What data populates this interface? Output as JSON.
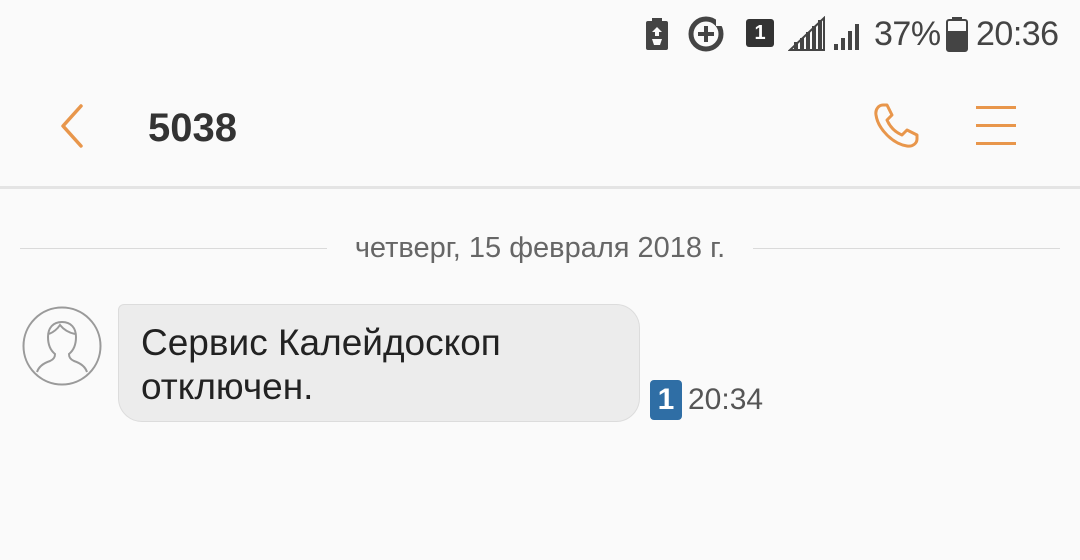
{
  "status_bar": {
    "sim_badge": "1",
    "battery_percent": "37%",
    "time": "20:36",
    "icons": [
      "battery-saver-icon",
      "data-saver-icon",
      "sim-1-icon",
      "signal-strength-icon",
      "signal-strength-icon",
      "battery-icon"
    ]
  },
  "header": {
    "title": "5038",
    "back_icon": "chevron-left-icon",
    "call_icon": "phone-icon",
    "menu_icon": "menu-icon",
    "accent_color": "#e8964b"
  },
  "conversation": {
    "date_divider": "четверг, 15 февраля 2018 г.",
    "messages": [
      {
        "direction": "incoming",
        "text": "Сервис Калейдоскоп отключен.",
        "sim": "1",
        "time": "20:34",
        "avatar_icon": "person-avatar-icon"
      }
    ]
  },
  "colors": {
    "background": "#fafafa",
    "bubble": "#ececec",
    "sim_badge_blue": "#2f6ea5"
  }
}
